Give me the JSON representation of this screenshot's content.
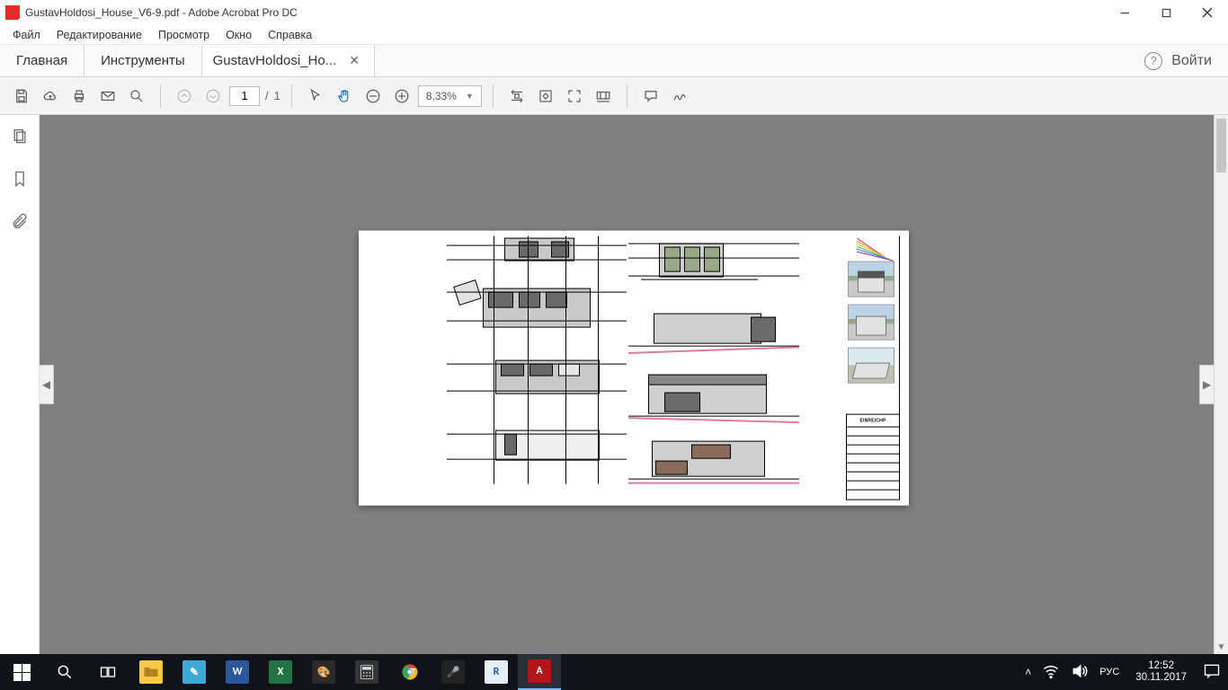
{
  "titlebar": {
    "title": "GustavHoldosi_House_V6-9.pdf - Adobe Acrobat Pro DC"
  },
  "menu": {
    "file": "Файл",
    "edit": "Редактирование",
    "view": "Просмотр",
    "window": "Окно",
    "help": "Справка"
  },
  "tabs": {
    "home": "Главная",
    "tools": "Инструменты",
    "doc": "GustavHoldosi_Ho...",
    "login": "Войти"
  },
  "toolbar": {
    "page_current": "1",
    "page_sep": "/",
    "page_total": "1",
    "zoom": "8,33%"
  },
  "pdf": {
    "titleblock_header": "EINREICHP"
  },
  "tray": {
    "lang": "РУС",
    "time": "12:52",
    "date": "30.11.2017"
  }
}
